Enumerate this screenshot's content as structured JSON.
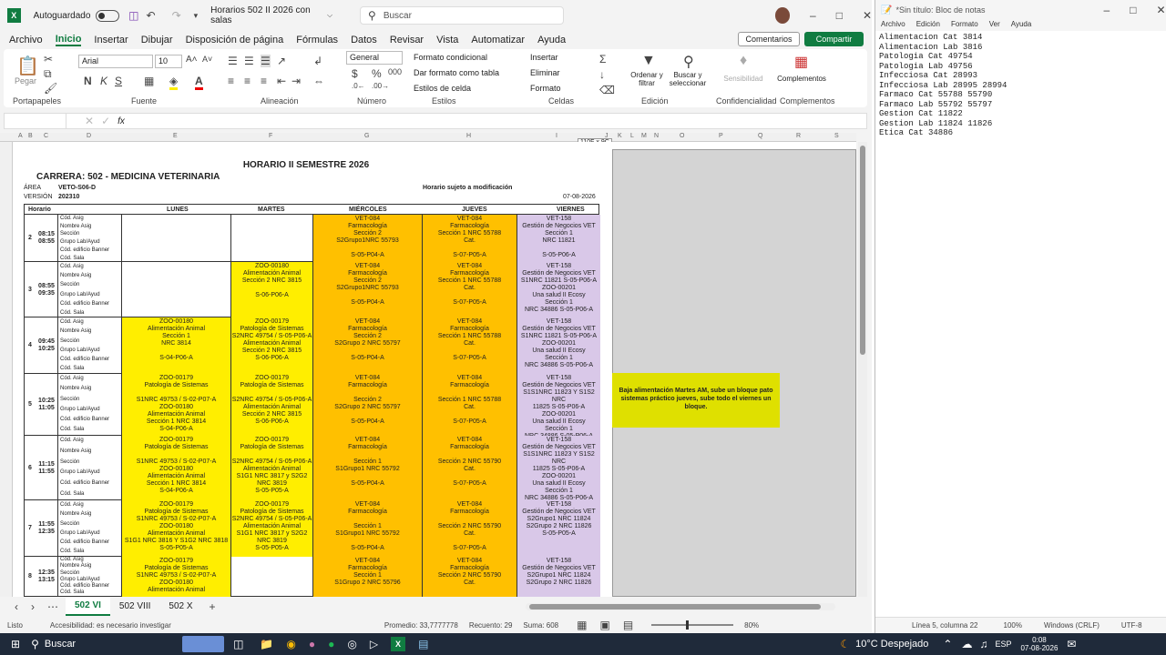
{
  "titlebar": {
    "autosave": "Autoguardado",
    "filename": "Horarios 502 II 2026 con salas",
    "search": "Buscar"
  },
  "tabs": [
    "Archivo",
    "Inicio",
    "Insertar",
    "Dibujar",
    "Disposición de página",
    "Fórmulas",
    "Datos",
    "Revisar",
    "Vista",
    "Automatizar",
    "Ayuda"
  ],
  "ribbon": {
    "comentarios": "Comentarios",
    "compartir": "Compartir",
    "pegar": "Pegar",
    "font": "Arial",
    "size": "10",
    "numfmt": "General",
    "formato_cond": "Formato condicional",
    "dar_formato": "Dar formato como tabla",
    "estilos": "Estilos de celda",
    "insertar": "Insertar",
    "eliminar": "Eliminar",
    "formato": "Formato",
    "ordenar": "Ordenar y filtrar",
    "buscar": "Buscar y seleccionar",
    "sensibilidad": "Sensibilidad",
    "complementos": "Complementos",
    "groups": [
      "Portapapeles",
      "Fuente",
      "Alineación",
      "Número",
      "Estilos",
      "Celdas",
      "Edición",
      "Confidencialidad",
      "Complementos"
    ]
  },
  "formula": {
    "fx": "fx",
    "tooltip": "110F x 9C"
  },
  "columns": [
    "A",
    "B",
    "C",
    "D",
    "E",
    "F",
    "G",
    "H",
    "I",
    "J",
    "K",
    "L",
    "M",
    "N",
    "O",
    "P",
    "Q",
    "R",
    "S"
  ],
  "sheet": {
    "title": "HORARIO II SEMESTRE 2026",
    "carrera": "CARRERA: 502 - MEDICINA VETERINARIA",
    "area_l": "ÁREA",
    "area_v": "VETO-S06-D",
    "version_l": "VERSIÓN",
    "version_v": "202310",
    "note": "Horario sujeto a modificación",
    "date": "07-08-2026",
    "headers": [
      "Horario",
      "",
      "LUNES",
      "MARTES",
      "MIÉRCOLES",
      "JUEVES",
      "VIERNES"
    ],
    "rowlabels": [
      "Cód. Asig",
      "Nombre Asig",
      "Sección",
      "Grupo Lab/Ayud",
      "Cód. edificio Banner",
      "Cód. Sala"
    ],
    "blocks": [
      {
        "n": "2",
        "t": "08:15\n08:55",
        "lun": "",
        "mar": "",
        "mie": "VET-084\nFarmacología\nSección 2\nS2Grupo1NRC 55793\n\nS-05-P04-A",
        "jue": "VET-084\nFarmacología\nSección 1 NRC 55788\nCat.\n\nS-07-P05-A",
        "vie": "VET-158\nGestión de Negocios VET\nSección 1\nNRC 11821\n\nS-05-P06-A"
      },
      {
        "n": "3",
        "t": "08:55\n09:35",
        "lun": "",
        "mar": "ZOO-00180\nAlimentación Animal\nSección 2 NRC 3815\n\nS-06-P06-A",
        "mie": "VET-084\nFarmacología\nSección 2\nS2Grupo1NRC 55793\n\nS-05-P04-A",
        "jue": "VET-084\nFarmacología\nSección 1 NRC 55788\nCat.\n\nS-07-P05-A",
        "vie": "VET-158\nGestión de Negocios VET\nS1NRC 11821 S-05-P06-A\nZOO-00201\nUna salud II Ecosy\nSección 1\nNRC 34886 S-05-P06-A"
      },
      {
        "n": "4",
        "t": "09:45\n10:25",
        "lun": "ZOO-00180\nAlimentación Animal\nSección 1\nNRC 3814\n\nS-04-P06-A",
        "mar": "ZOO-00179\nPatología de Sistemas\nS2NRC 49754 / S-05-P06-A\nAlimentación Animal\nSección 2 NRC 3815\nS-06-P06-A",
        "mie": "VET-084\nFarmacología\nSección 2\nS2Grupo 2 NRC 55797\n\nS-05-P04-A",
        "jue": "VET-084\nFarmacología\nSección 1 NRC 55788\nCat.\n\nS-07-P05-A",
        "vie": "VET-158\nGestión de Negocios VET\nS1NRC 11821 S-05-P06-A\nZOO-00201\nUna salud II Ecosy\nSección 1\nNRC 34886 S-05-P06-A"
      },
      {
        "n": "5",
        "t": "10:25\n11:05",
        "lun": "ZOO-00179\nPatología de Sistemas\n\nS1NRC 49753 / S-02-P07-A\nZOO-00180\nAlimentación Animal\nSección 1 NRC 3814\nS-04-P06-A",
        "mar": "ZOO-00179\nPatología de Sistemas\n\nS2NRC 49754 / S-05-P06-A\nAlimentación Animal\nSección 2 NRC 3815\nS-06-P06-A",
        "mie": "VET-084\nFarmacología\n\nSección 2\nS2Grupo 2 NRC 55797\n\nS-05-P04-A",
        "jue": "VET-084\nFarmacología\n\nSección 1 NRC 55788\nCat.\n\nS-07-P05-A",
        "vie": "VET-158\nGestión de Negocios VET\nS1S1NRC 11823 Y S1S2 NRC\n11825 S-05-P06-A\nZOO-00201\nUna salud II Ecosy\nSección 1\nNRC 34886 S-05-P06-A"
      },
      {
        "n": "6",
        "t": "11:15\n11:55",
        "lun": "ZOO-00179\nPatología de Sistemas\n\nS1NRC 49753 / S-02-P07-A\nZOO-00180\nAlimentación Animal\nSección 1 NRC 3814\nS-04-P06-A",
        "mar": "ZOO-00179\nPatología de Sistemas\n\nS2NRC 49754 / S-05-P06-A\nAlimentación Animal\nS1G1 NRC 3817 y S2G2 NRC 3819\nS-05-P05-A",
        "mie": "VET-084\nFarmacología\n\nSección 1\nS1Grupo1 NRC 55792\n\nS-05-P04-A",
        "jue": "VET-084\nFarmacología\n\nSección 2 NRC 55790\nCat.\n\nS-07-P05-A",
        "vie": "VET-158\nGestión de Negocios VET\nS1S1NRC 11823 Y S1S2 NRC\n11825 S-05-P06-A\nZOO-00201\nUna salud II Ecosy\nSección 1\nNRC 34886 S-05-P06-A"
      },
      {
        "n": "7",
        "t": "11:55\n12:35",
        "lun": "ZOO-00179\nPatología de Sistemas\nS1NRC 49753 / S-02-P07-A\nZOO-00180\nAlimentación Animal\nS1G1 NRC 3816 Y S1G2 NRC 3818\nS-05-P05-A",
        "mar": "ZOO-00179\nPatología de Sistemas\nS2NRC 49754 / S-05-P06-A\nAlimentación Animal\nS1G1 NRC 3817 y S2G2 NRC 3819\nS-05-P05-A",
        "mie": "VET-084\nFarmacología\n\nSección 1\nS1Grupo1 NRC 55792\n\nS-05-P04-A",
        "jue": "VET-084\nFarmacología\n\nSección 2 NRC 55790\nCat.\n\nS-07-P05-A",
        "vie": "VET-158\nGestión de Negocios VET\nS2Grupo1 NRC 11824\nS2Grupo 2 NRC 11826\nS-05-P05-A"
      },
      {
        "n": "8",
        "t": "12:35\n13:15",
        "lun": "ZOO-00179\nPatología de Sistemas\nS1NRC 49753 / S-02-P07-A\nZOO-00180\nAlimentación Animal",
        "mar": "",
        "mie": "VET-084\nFarmacología\nSección 1\nS1Grupo 2 NRC 55796",
        "jue": "VET-084\nFarmacología\nSección 2 NRC 55790\nCat.",
        "vie": "VET-158\nGestión de Negocios VET\nS2Grupo1 NRC 11824\nS2Grupo 2 NRC 11826"
      }
    ],
    "sticky": "Baja alimentación Martes AM, sube un bloque pato sistemas práctico jueves, sube todo el viernes un bloque."
  },
  "sheettabs": [
    "502 VI",
    "502 VIII",
    "502 X"
  ],
  "status": {
    "listo": "Listo",
    "acc": "Accesibilidad: es necesario investigar",
    "promedio": "Promedio: 33,7777778",
    "recuento": "Recuento: 29",
    "suma": "Suma: 608",
    "zoom": "80%"
  },
  "notepad": {
    "title": "*Sin título: Bloc de notas",
    "menu": [
      "Archivo",
      "Edición",
      "Formato",
      "Ver",
      "Ayuda"
    ],
    "lines": [
      "Alimentacion Cat 3814",
      "Alimentacion Lab 3816",
      "Patologia Cat 49754",
      "Patologia Lab 49756",
      "Infecciosa Cat 28993",
      "Infecciosa Lab 28995 28994",
      "Farmaco Cat 55788 55790",
      "Farmaco Lab 55792 55797",
      "Gestion Cat 11822",
      "Gestion Lab 11824 11826",
      "Etica Cat 34886"
    ],
    "status": [
      "Línea 5, columna 22",
      "100%",
      "Windows (CRLF)",
      "UTF-8"
    ],
    "lang": "ESP"
  },
  "taskbar": {
    "search": "Buscar",
    "weather": "10°C Despejado",
    "lang": "ESP",
    "time": "0:08",
    "date": "07-08-2026"
  }
}
